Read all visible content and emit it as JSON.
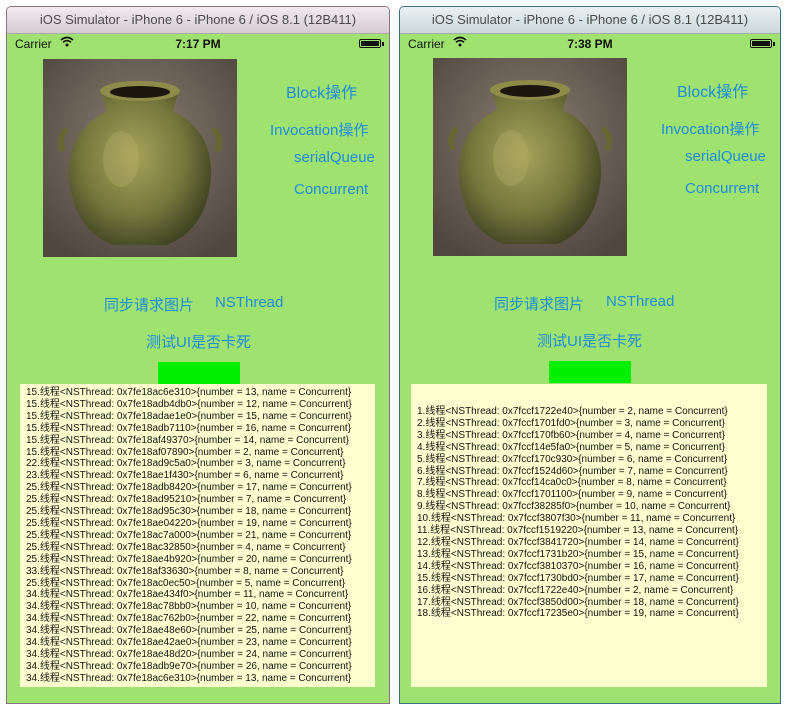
{
  "windows": [
    {
      "title": "iOS Simulator - iPhone 6 - iPhone 6 / iOS 8.1 (12B411)",
      "status": {
        "carrier": "Carrier",
        "time": "7:17 PM"
      },
      "buttons": {
        "block": "Block操作",
        "invocation": "Invocation操作",
        "serial_queue": "serialQueue",
        "concurrent": "Concurrent",
        "sync_image": "同步请求图片",
        "nsthread": "NSThread",
        "test_ui": "测试UI是否卡死"
      },
      "log": [
        "15.线程<NSThread: 0x7fe18ac6e310>{number = 13, name = Concurrent}",
        "15.线程<NSThread: 0x7fe18adb4db0>{number = 12, name = Concurrent}",
        "15.线程<NSThread: 0x7fe18adae1e0>{number = 15, name = Concurrent}",
        "15.线程<NSThread: 0x7fe18adb7110>{number = 16, name = Concurrent}",
        "15.线程<NSThread: 0x7fe18af49370>{number = 14, name = Concurrent}",
        "15.线程<NSThread: 0x7fe18af07890>{number = 2, name = Concurrent}",
        "22.线程<NSThread: 0x7fe18ad9c5a0>{number = 3, name = Concurrent}",
        "23.线程<NSThread: 0x7fe18ae1f430>{number = 6, name = Concurrent}",
        "25.线程<NSThread: 0x7fe18adb8420>{number = 17, name = Concurrent}",
        "25.线程<NSThread: 0x7fe18ad95210>{number = 7, name = Concurrent}",
        "25.线程<NSThread: 0x7fe18ad95c30>{number = 18, name = Concurrent}",
        "25.线程<NSThread: 0x7fe18ae04220>{number = 19, name = Concurrent}",
        "25.线程<NSThread: 0x7fe18ac7a000>{number = 21, name = Concurrent}",
        "25.线程<NSThread: 0x7fe18ac32850>{number = 4, name = Concurrent}",
        "25.线程<NSThread: 0x7fe18ae4b920>{number = 20, name = Concurrent}",
        "33.线程<NSThread: 0x7fe18af33630>{number = 8, name = Concurrent}",
        "25.线程<NSThread: 0x7fe18ac0ec50>{number = 5, name = Concurrent}",
        "34.线程<NSThread: 0x7fe18ae434f0>{number = 11, name = Concurrent}",
        "34.线程<NSThread: 0x7fe18ac78bb0>{number = 10, name = Concurrent}",
        "34.线程<NSThread: 0x7fe18ac762b0>{number = 22, name = Concurrent}",
        "34.线程<NSThread: 0x7fe18ae48e60>{number = 25, name = Concurrent}",
        "34.线程<NSThread: 0x7fe18ae42ae0>{number = 23, name = Concurrent}",
        "34.线程<NSThread: 0x7fe18ae48d20>{number = 24, name = Concurrent}",
        "34.线程<NSThread: 0x7fe18adb9e70>{number = 26, name = Concurrent}",
        "34.线程<NSThread: 0x7fe18ac6e310>{number = 13, name = Concurrent}"
      ]
    },
    {
      "title": "iOS Simulator - iPhone 6 - iPhone 6 / iOS 8.1 (12B411)",
      "status": {
        "carrier": "Carrier",
        "time": "7:38 PM"
      },
      "buttons": {
        "block": "Block操作",
        "invocation": "Invocation操作",
        "serial_queue": "serialQueue",
        "concurrent": "Concurrent",
        "sync_image": "同步请求图片",
        "nsthread": "NSThread",
        "test_ui": "测试UI是否卡死"
      },
      "log": [
        "1.线程<NSThread: 0x7fccf1722e40>{number = 2, name = Concurrent}",
        "2.线程<NSThread: 0x7fccf1701fd0>{number = 3, name = Concurrent}",
        "3.线程<NSThread: 0x7fccf170fb60>{number = 4, name = Concurrent}",
        "4.线程<NSThread: 0x7fccf14e5fa0>{number = 5, name = Concurrent}",
        "5.线程<NSThread: 0x7fccf170c930>{number = 6, name = Concurrent}",
        "6.线程<NSThread: 0x7fccf1524d60>{number = 7, name = Concurrent}",
        "7.线程<NSThread: 0x7fccf14ca0c0>{number = 8, name = Concurrent}",
        "8.线程<NSThread: 0x7fccf1701100>{number = 9, name = Concurrent}",
        "9.线程<NSThread: 0x7fccf38285f0>{number = 10, name = Concurrent}",
        "10.线程<NSThread: 0x7fccf3807f30>{number = 11, name = Concurrent}",
        "11.线程<NSThread: 0x7fccf1519220>{number = 13, name = Concurrent}",
        "12.线程<NSThread: 0x7fccf3841720>{number = 14, name = Concurrent}",
        "13.线程<NSThread: 0x7fccf1731b20>{number = 15, name = Concurrent}",
        "14.线程<NSThread: 0x7fccf3810370>{number = 16, name = Concurrent}",
        "15.线程<NSThread: 0x7fccf1730bd0>{number = 17, name = Concurrent}",
        "16.线程<NSThread: 0x7fccf1722e40>{number = 2, name = Concurrent}",
        "17.线程<NSThread: 0x7fccf3850d00>{number = 18, name = Concurrent}",
        "18.线程<NSThread: 0x7fccf17235e0>{number = 19, name = Concurrent}"
      ]
    }
  ],
  "icons": {
    "wifi": "wifi-icon",
    "battery": "battery-icon",
    "photo": "bronze-jar-photo"
  },
  "colors": {
    "screen_bg": "#9fe270",
    "link": "#1f8ce0",
    "green_box": "#00ee00",
    "log_bg": "#ffffcf"
  }
}
